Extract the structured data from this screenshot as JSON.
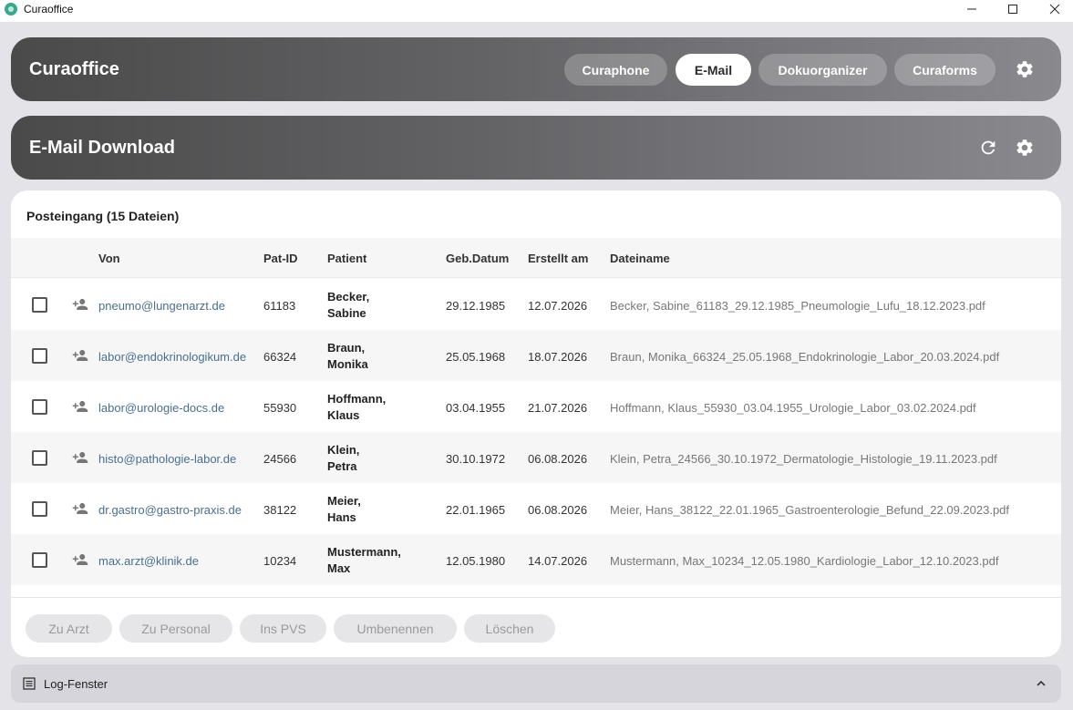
{
  "window": {
    "title": "Curaoffice"
  },
  "app_header": {
    "title": "Curaoffice",
    "tabs": [
      {
        "label": "Curaphone",
        "active": false
      },
      {
        "label": "E-Mail",
        "active": true
      },
      {
        "label": "Dokuorganizer",
        "active": false
      },
      {
        "label": "Curaforms",
        "active": false
      }
    ],
    "settings_icon": "gear-icon"
  },
  "section_header": {
    "title": "E-Mail Download",
    "icons": [
      "refresh-icon",
      "gear-icon"
    ]
  },
  "inbox": {
    "title": "Posteingang (15 Dateien)",
    "columns": {
      "von": "Von",
      "pat_id": "Pat-ID",
      "patient": "Patient",
      "geb_datum": "Geb.Datum",
      "erstellt_am": "Erstellt am",
      "dateiname": "Dateiname"
    },
    "rows": [
      {
        "von": "pneumo@lungenarzt.de",
        "pat_id": "61183",
        "patient_line1": "Becker,",
        "patient_line2": "Sabine",
        "geb_datum": "29.12.1985",
        "erstellt_am": "12.07.2026",
        "dateiname": "Becker, Sabine_61183_29.12.1985_Pneumologie_Lufu_18.12.2023.pdf"
      },
      {
        "von": "labor@endokrinologikum.de",
        "pat_id": "66324",
        "patient_line1": "Braun,",
        "patient_line2": "Monika",
        "geb_datum": "25.05.1968",
        "erstellt_am": "18.07.2026",
        "dateiname": "Braun, Monika_66324_25.05.1968_Endokrinologie_Labor_20.03.2024.pdf"
      },
      {
        "von": "labor@urologie-docs.de",
        "pat_id": "55930",
        "patient_line1": "Hoffmann,",
        "patient_line2": "Klaus",
        "geb_datum": "03.04.1955",
        "erstellt_am": "21.07.2026",
        "dateiname": "Hoffmann, Klaus_55930_03.04.1955_Urologie_Labor_03.02.2024.pdf"
      },
      {
        "von": "histo@pathologie-labor.de",
        "pat_id": "24566",
        "patient_line1": "Klein,",
        "patient_line2": "Petra",
        "geb_datum": "30.10.1972",
        "erstellt_am": "06.08.2026",
        "dateiname": "Klein, Petra_24566_30.10.1972_Dermatologie_Histologie_19.11.2023.pdf"
      },
      {
        "von": "dr.gastro@gastro-praxis.de",
        "pat_id": "38122",
        "patient_line1": "Meier,",
        "patient_line2": "Hans",
        "geb_datum": "22.01.1965",
        "erstellt_am": "06.08.2026",
        "dateiname": "Meier, Hans_38122_22.01.1965_Gastroenterologie_Befund_22.09.2023.pdf"
      },
      {
        "von": "max.arzt@klinik.de",
        "pat_id": "10234",
        "patient_line1": "Mustermann,",
        "patient_line2": "Max",
        "geb_datum": "12.05.1980",
        "erstellt_am": "14.07.2026",
        "dateiname": "Mustermann, Max_10234_12.05.1980_Kardiologie_Labor_12.10.2023.pdf"
      }
    ]
  },
  "actions": {
    "zu_arzt": "Zu Arzt",
    "zu_personal": "Zu Personal",
    "ins_pvs": "Ins PVS",
    "umbenennen": "Umbenennen",
    "loeschen": "Löschen"
  },
  "log": {
    "label": "Log-Fenster"
  },
  "colors": {
    "header_dark": "#4a4a4a",
    "header_light": "#8a898e",
    "link": "#4a6f8f",
    "background": "#e4e3e8"
  }
}
